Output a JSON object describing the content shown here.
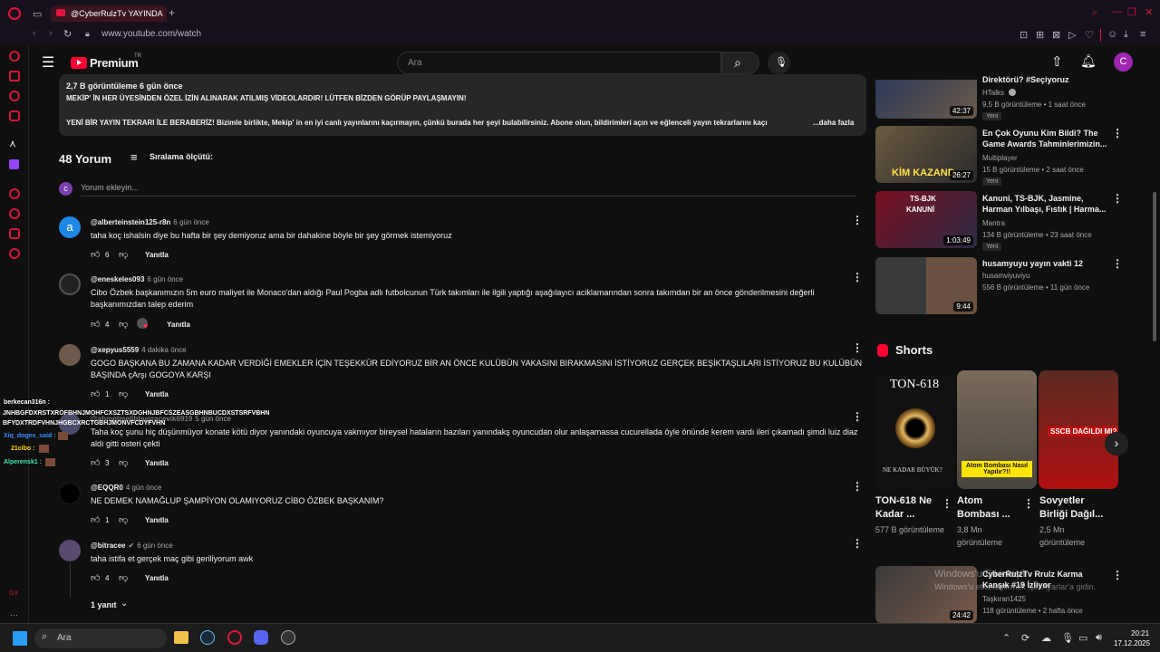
{
  "browser": {
    "tab_title": "@CyberRulzTv YAYINDA",
    "url": "www.youtube.com/watch"
  },
  "youtube": {
    "logo": "Premium",
    "logo_sup": "TR",
    "search_placeholder": "Ara",
    "user_initial": "C"
  },
  "description": {
    "stats": "2,7 B görüntüleme  6 gün önce",
    "line1": "MEKİP' İN HER ÜYESİNDEN ÖZEL İZİN ALINARAK  ATILMIŞ VİDEOLARDIR! LÜTFEN BİZDEN GÖRÜP PAYLAŞMAYIN!",
    "line2": "YENİ BİR YAYIN TEKRARI İLE BERABERİZ! Bizimle birlikte, Mekip' in en iyi canlı yayınlarını kaçırmayın, çünkü burada her şeyi bulabilirsiniz. Abone olun, bildirimleri açın ve eğlenceli yayın tekrarlarını kaçı",
    "more": "...daha fazla"
  },
  "comments_header": {
    "count": "48 Yorum",
    "sort": "Sıralama ölçütü:",
    "add_placeholder": "Yorum ekleyin...",
    "user_initial": "c"
  },
  "comments": [
    {
      "user": "@alberteinstein125-r8n",
      "time": "6 gün önce",
      "text": "taha koç ishalsin diye bu hafta bir şey demiyoruz ama bir dahakine böyle bir şey görmek istemiyoruz",
      "likes": "6",
      "reply": "Yanıtla",
      "initial": "a"
    },
    {
      "user": "@eneskeles093",
      "time": "6 gün önce",
      "text": "Cibo Özbek başkanımızın 5m euro maliyet ile Monaco'dan aldığı Paul Pogba adlı futbolcunun Türk takımları ile ilgili yaptığı aşağılayıcı aciklamarından sonra takımdan bir an önce gönderilmesini değerli başkanımızdan talep ederim",
      "likes": "4",
      "reply": "Yanıtla"
    },
    {
      "user": "@xepyus5559",
      "time": "4 dakika önce",
      "text": "GOGO BAŞKANA BU ZAMANA KADAR VERDİĞİ EMEKLER İÇİN TEŞEKKÜR EDİYORUZ BİR AN ÖNCE KULÜBÜN YAKASINI BIRAKMASINI İSTİYORUZ GERÇEK BEŞİKTAŞLILARI İSTİYORUZ BU KULÜBÜN BAŞINDA çArşı GOGOYA KARŞI",
      "likes": "1",
      "reply": "Yanıtla"
    },
    {
      "user": "@ahmetmelihbugracevik6919",
      "time": "5 gün önce",
      "text": "Taha koç şunu hiç düşünmüyor konate kötü diyor yanındaki oyuncuya vakmıyor bireysel hataların bazıları yanındakş oyuncudan olur anlaşamassa cucurellada öyle önünde kerem vardı ileri çıkamadı şimdi luiz diaz aldı gitti osteri çekti",
      "likes": "3",
      "reply": "Yanıtla"
    },
    {
      "user": "@EQQR0",
      "time": "4 gün önce",
      "text": "NE DEMEK NAMAĞLUP ŞAMPİYON OLAMIYORUZ CİBO ÖZBEK BAŞKANIM?",
      "likes": "1",
      "reply": "Yanıtla"
    },
    {
      "user": "@bitracee",
      "time": "6 gün önce",
      "text": "taha istifa et gerçek maç gibi geriliyorum awk",
      "likes": "4",
      "reply": "Yanıtla",
      "replies": "1 yanıt"
    }
  ],
  "chat_overlay": [
    {
      "name": "berkecan316n :",
      "color": "#ffffff"
    },
    {
      "name": "JNHBGFDXRSTXROFBHNJMOHFCXSZTSXDGHNJBFCSZEASGBHNBUCDXSTSRFVBHN",
      "color": "#ffffff"
    },
    {
      "name": "BFYDXTRDFVHNJHGBCXRCTGBHJMONVFCDYFVHN",
      "color": "#ffffff"
    },
    {
      "name": "Xiq_dogex_said :",
      "color": "#3a8bff"
    },
    {
      "name": "21cibo :",
      "color": "#ffd600"
    },
    {
      "name": "Alperensk1 :",
      "color": "#43e8b0"
    }
  ],
  "related": [
    {
      "title": "Direktörü? #Seçiyoruz",
      "channel": "HTalks",
      "meta": "9,5 B görüntüleme • 1 saat önce",
      "badge": "Yeni",
      "duration": "42:37"
    },
    {
      "title": "En Çok Oyunu Kim Bildi? The Game Awards Tahminlerimizin...",
      "channel": "Multiplayer",
      "meta": "15 B görüntüleme • 2 saat önce",
      "badge": "Yeni",
      "duration": "26:27"
    },
    {
      "title": "Kanuni, TS-BJK, Jasmine, Harman Yılbaşı, Fıstık | Harma...",
      "channel": "Mantra",
      "meta": "134 B görüntüleme • 23 saat önce",
      "badge": "Yeni",
      "duration": "1:03:49"
    },
    {
      "title": "husamyuyu yayın vakti 12",
      "channel": "husamviyuviyu",
      "meta": "556 B görüntüleme • 11 gün önce",
      "duration": "9:44"
    }
  ],
  "shorts": {
    "header": "Shorts",
    "items": [
      {
        "title": "TON-618 Ne Kadar ...",
        "views": "577 B görüntüleme",
        "thumb_text": "TON-618",
        "thumb_sub": "NE KADAR BÜYÜK?"
      },
      {
        "title": "Atom Bombası ...",
        "views": "3,8 Mn görüntüleme",
        "thumb_text": "Atom Bombası Nasıl Yapılır?!!"
      },
      {
        "title": "Sovyetler Birliği Dağıl...",
        "views": "2,5 Mn görüntüleme",
        "thumb_text": "SSCB DAĞILDI MI?"
      }
    ]
  },
  "related_bottom": {
    "title": "CyberRulzTv Rrulz Karma Kanşık #19 İzliyor",
    "channel": "Taşkıran1425",
    "meta": "118 görüntüleme • 2 hafta önce",
    "duration": "24:42"
  },
  "watermark": {
    "line1": "Windows'u Etkinleştir",
    "line2": "Windows'u etkinleştirmek için Ayarlar'a gidin."
  },
  "taskbar": {
    "search": "Ara",
    "time": "20:21",
    "date": "17.12.2025"
  }
}
